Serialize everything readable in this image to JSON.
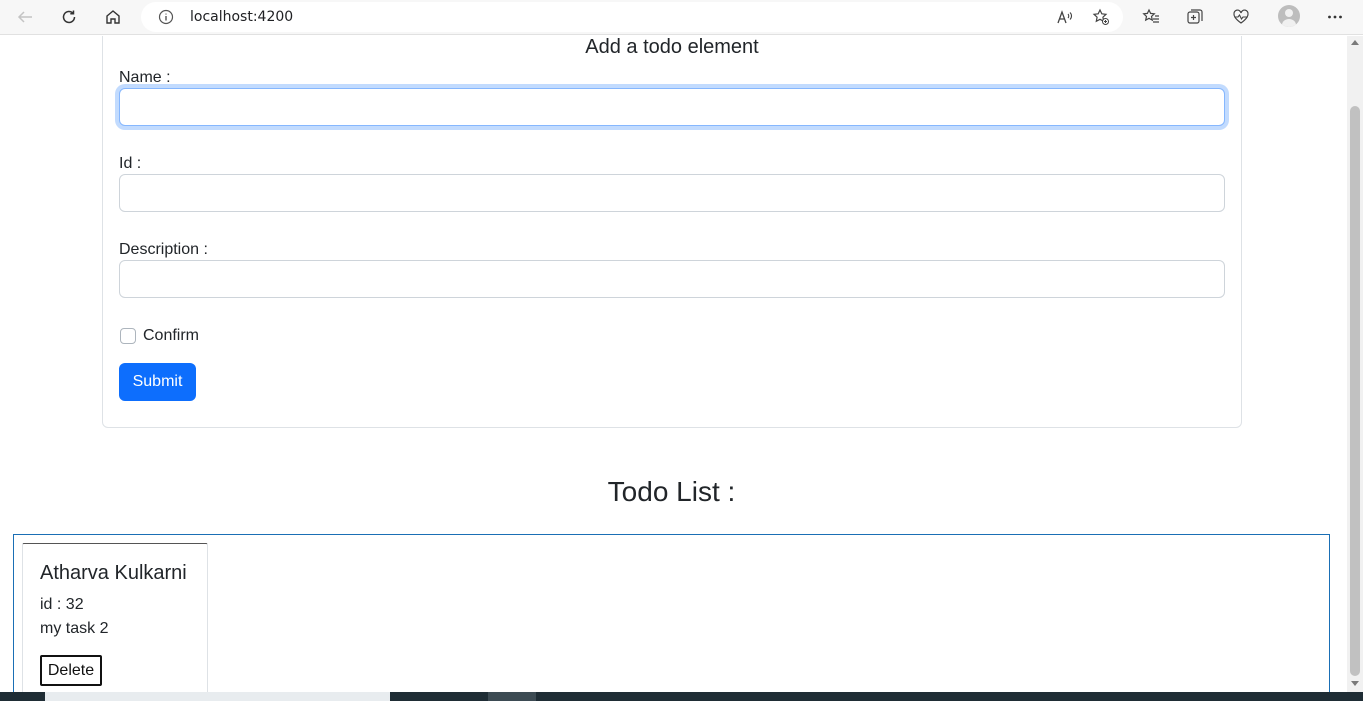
{
  "browser": {
    "url": "localhost:4200"
  },
  "form": {
    "title": "Add a todo element",
    "name_label": "Name :",
    "name_value": "",
    "id_label": "Id :",
    "id_value": "",
    "description_label": "Description :",
    "description_value": "",
    "confirm_label": "Confirm",
    "confirm_checked": false,
    "submit_label": "Submit"
  },
  "todo_list": {
    "title": "Todo List :",
    "items": [
      {
        "name": "Atharva Kulkarni",
        "id_text": "id : 32",
        "description": "my task 2",
        "delete_label": "Delete"
      }
    ]
  },
  "colors": {
    "primary": "#0d6efd",
    "list_border": "#1a6fb5",
    "focus_ring": "#86b7fe"
  }
}
